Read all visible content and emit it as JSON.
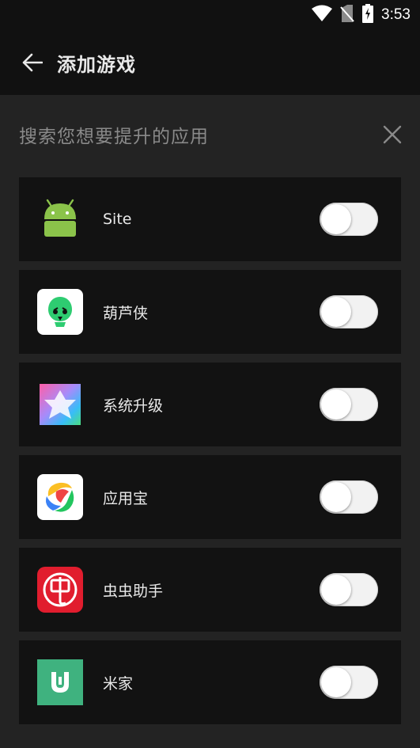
{
  "statusbar": {
    "time": "3:53"
  },
  "appbar": {
    "title": "添加游戏"
  },
  "search": {
    "placeholder": "搜索您想要提升的应用"
  },
  "apps": [
    {
      "name": "Site",
      "icon": "android-icon",
      "enabled": false
    },
    {
      "name": "葫芦侠",
      "icon": "huluxia-icon",
      "enabled": false
    },
    {
      "name": "系统升级",
      "icon": "system-update-icon",
      "enabled": false
    },
    {
      "name": "应用宝",
      "icon": "yingyongbao-icon",
      "enabled": false
    },
    {
      "name": "虫虫助手",
      "icon": "chongchong-icon",
      "enabled": false
    },
    {
      "name": "米家",
      "icon": "mijia-icon",
      "enabled": false
    }
  ]
}
